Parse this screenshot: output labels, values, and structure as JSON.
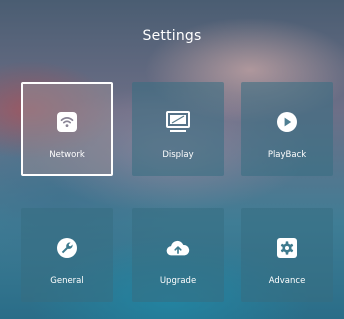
{
  "header": {
    "title": "Settings"
  },
  "tiles": [
    {
      "label": "Network",
      "icon": "wifi-icon"
    },
    {
      "label": "Display",
      "icon": "monitor-icon"
    },
    {
      "label": "PlayBack",
      "icon": "play-icon"
    },
    {
      "label": "General",
      "icon": "wrench-icon"
    },
    {
      "label": "Upgrade",
      "icon": "cloud-upload-icon"
    },
    {
      "label": "Advance",
      "icon": "gear-icon"
    }
  ],
  "selected_tile": "Network"
}
